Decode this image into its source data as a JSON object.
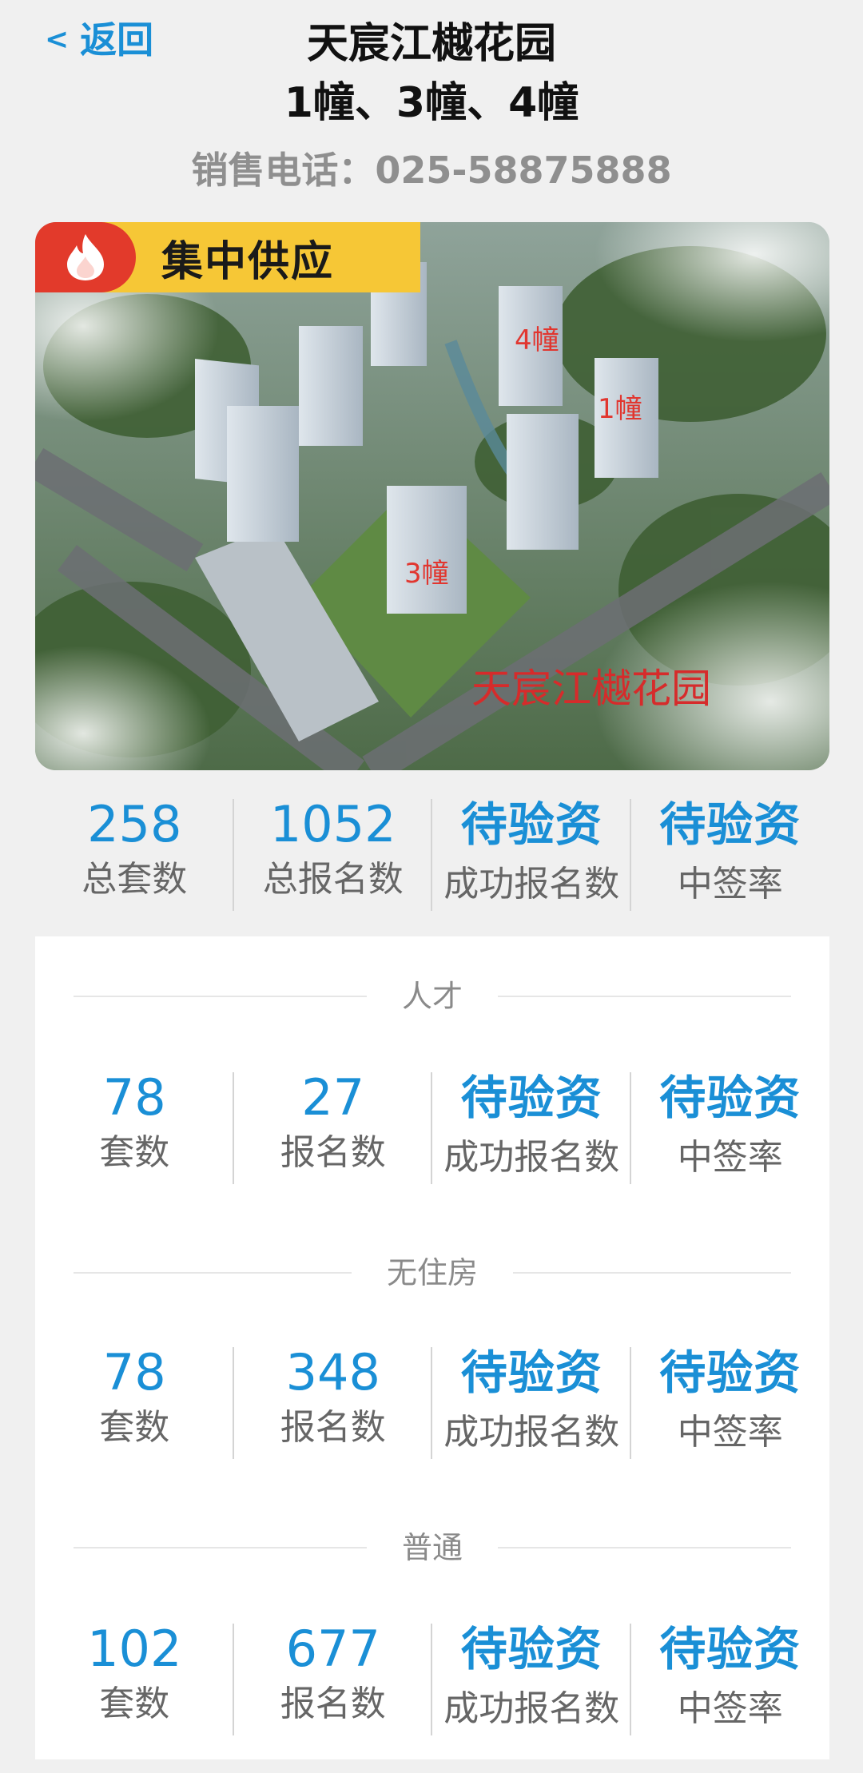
{
  "header": {
    "back_label": "返回",
    "title_line1": "天宸江樾花园",
    "title_line2": "1幢、3幢、4幢",
    "phone": "销售电话：025-58875888"
  },
  "hero": {
    "badge": "集中供应",
    "building_labels": [
      "4幢",
      "1幢",
      "3幢"
    ],
    "watermark": "天宸江樾花园"
  },
  "summary": [
    {
      "value": "258",
      "label": "总套数"
    },
    {
      "value": "1052",
      "label": "总报名数"
    },
    {
      "value": "待验资",
      "label": "成功报名数"
    },
    {
      "value": "待验资",
      "label": "中签率"
    }
  ],
  "sections": [
    {
      "name": "人才",
      "stats": [
        {
          "value": "78",
          "label": "套数"
        },
        {
          "value": "27",
          "label": "报名数"
        },
        {
          "value": "待验资",
          "label": "成功报名数"
        },
        {
          "value": "待验资",
          "label": "中签率"
        }
      ]
    },
    {
      "name": "无住房",
      "stats": [
        {
          "value": "78",
          "label": "套数"
        },
        {
          "value": "348",
          "label": "报名数"
        },
        {
          "value": "待验资",
          "label": "成功报名数"
        },
        {
          "value": "待验资",
          "label": "中签率"
        }
      ]
    },
    {
      "name": "普通",
      "stats": [
        {
          "value": "102",
          "label": "套数"
        },
        {
          "value": "677",
          "label": "报名数"
        },
        {
          "value": "待验资",
          "label": "成功报名数"
        },
        {
          "value": "待验资",
          "label": "中签率"
        }
      ]
    }
  ],
  "colors": {
    "accent": "#1a8fd6",
    "badge_red": "#e23a2b",
    "badge_yellow": "#f6c736"
  }
}
